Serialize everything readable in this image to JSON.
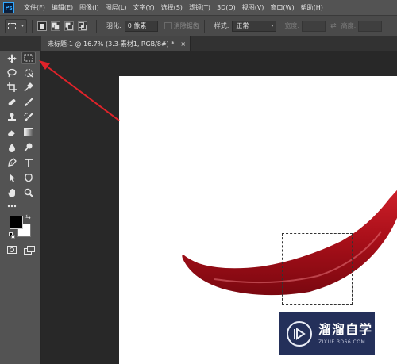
{
  "app": {
    "logo_text": "Ps"
  },
  "menu": [
    "文件(F)",
    "编辑(E)",
    "图像(I)",
    "图层(L)",
    "文字(Y)",
    "选择(S)",
    "滤镜(T)",
    "3D(D)",
    "视图(V)",
    "窗口(W)",
    "帮助(H)"
  ],
  "options": {
    "feather_label": "羽化:",
    "feather_value": "0 像素",
    "antialias_label": "消除锯齿",
    "style_label": "样式:",
    "style_value": "正常",
    "width_label": "宽度:",
    "height_label": "高度:"
  },
  "document": {
    "tab_title": "未标题-1 @ 16.7% (3.3-素材1, RGB/8#) *",
    "close_glyph": "×"
  },
  "watermark": {
    "title": "溜溜自学",
    "url": "ZIXUE.3D66.COM"
  },
  "colors": {
    "foreground": "#000000",
    "background": "#ffffff",
    "arrow": "#e0232a",
    "chili": "#b5121b"
  }
}
